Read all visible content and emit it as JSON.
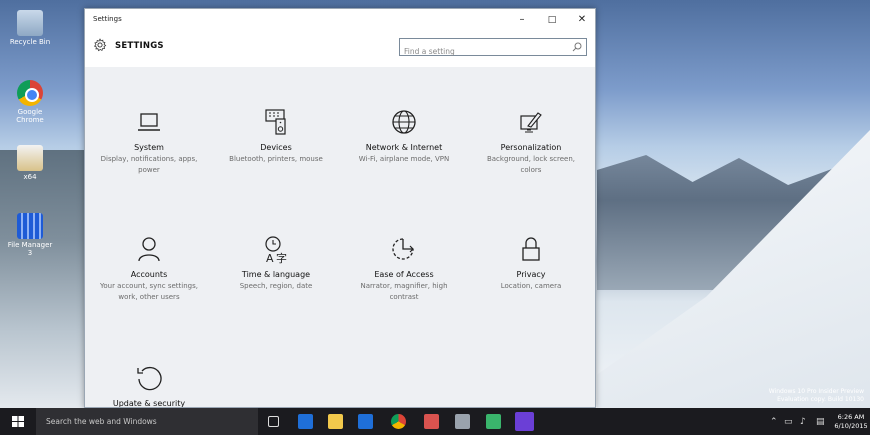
{
  "desktop": {
    "icons": [
      {
        "label": "Recycle Bin",
        "icon": "recycle-bin-icon"
      },
      {
        "label": "Google Chrome",
        "icon": "chrome-icon"
      },
      {
        "label": "x64",
        "icon": "file-icon"
      },
      {
        "label": "File Manager 3",
        "icon": "file-manager-icon"
      }
    ],
    "watermark": [
      "Windows 10 Pro Insider Preview",
      "Evaluation copy. Build 10130"
    ]
  },
  "window": {
    "title": "Settings",
    "header_title": "SETTINGS",
    "search_placeholder": "Find a setting",
    "controls": {
      "minimize": "–",
      "maximize": "□",
      "close": "✕"
    }
  },
  "tiles": [
    {
      "title": "System",
      "desc": "Display, notifications, apps, power",
      "icon": "laptop-icon"
    },
    {
      "title": "Devices",
      "desc": "Bluetooth, printers, mouse",
      "icon": "devices-icon"
    },
    {
      "title": "Network & Internet",
      "desc": "Wi-Fi, airplane mode, VPN",
      "icon": "globe-icon"
    },
    {
      "title": "Personalization",
      "desc": "Background, lock screen, colors",
      "icon": "paintbrush-icon"
    },
    {
      "title": "Accounts",
      "desc": "Your account, sync settings, work, other users",
      "icon": "person-icon"
    },
    {
      "title": "Time & language",
      "desc": "Speech, region, date",
      "icon": "time-language-icon"
    },
    {
      "title": "Ease of Access",
      "desc": "Narrator, magnifier, high contrast",
      "icon": "ease-of-access-icon"
    },
    {
      "title": "Privacy",
      "desc": "Location, camera",
      "icon": "lock-icon"
    },
    {
      "title": "Update & security",
      "desc": "",
      "icon": "update-icon"
    }
  ],
  "taskbar": {
    "search_text": "Search the web and Windows",
    "clock_time": "6:26 AM",
    "clock_date": "6/10/2015"
  }
}
